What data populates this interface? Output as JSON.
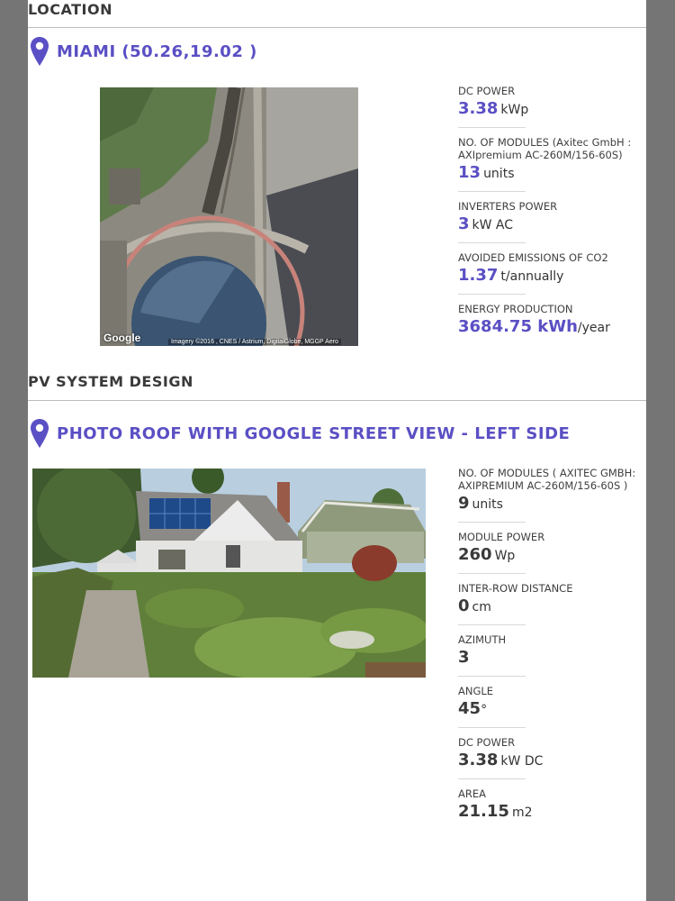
{
  "location": {
    "section_title": "LOCATION",
    "place": "MIAMI (50.26,19.02 )",
    "map_logo": "Google",
    "map_credit": "Imagery ©2016 , CNES / Astrium, DigitalGlobe, MGGP Aero",
    "stats": [
      {
        "label": "DC POWER",
        "value": "3.38",
        "unit": "kWp"
      },
      {
        "label": "NO. OF MODULES (Axitec GmbH : AXIpremium AC-260M/156-60S)",
        "value": "13",
        "unit": "units"
      },
      {
        "label": "INVERTERS POWER",
        "value": "3",
        "unit": "kW AC"
      },
      {
        "label": "AVOIDED EMISSIONS OF CO2",
        "value": "1.37",
        "unit": "t/annually"
      },
      {
        "label": "ENERGY PRODUCTION",
        "value": "3684.75 kWh",
        "unit": "/year"
      }
    ]
  },
  "design": {
    "section_title": "PV SYSTEM DESIGN",
    "photo_title": "PHOTO ROOF WITH GOOGLE STREET VIEW - LEFT SIDE",
    "stats": [
      {
        "label": "NO. OF MODULES ( AXITEC GMBH: AXIPREMIUM AC-260M/156-60S )",
        "value": "9",
        "unit": "units"
      },
      {
        "label": "MODULE POWER",
        "value": "260",
        "unit": "Wp"
      },
      {
        "label": "INTER-ROW DISTANCE",
        "value": "0",
        "unit": "cm"
      },
      {
        "label": "AZIMUTH",
        "value": "3",
        "unit": ""
      },
      {
        "label": "ANGLE",
        "value": "45",
        "unit": "°"
      },
      {
        "label": "DC POWER",
        "value": "3.38",
        "unit": "kW DC"
      },
      {
        "label": "AREA",
        "value": "21.15",
        "unit": "m2"
      }
    ]
  },
  "colors": {
    "accent": "#5a4fc4",
    "text": "#3a3a3a",
    "backdrop": "#757575"
  },
  "icons": {
    "pin": "map-pin-icon"
  }
}
